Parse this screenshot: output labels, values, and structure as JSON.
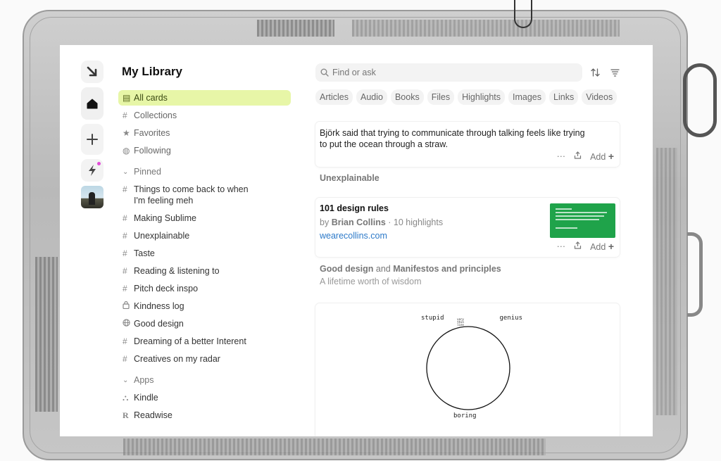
{
  "library": {
    "title": "My Library",
    "top_items": [
      {
        "label": "All cards",
        "icon": "cards-icon"
      },
      {
        "label": "Collections",
        "icon": "hash-icon"
      },
      {
        "label": "Favorites",
        "icon": "star-icon"
      },
      {
        "label": "Following",
        "icon": "following-icon"
      }
    ],
    "pinned_label": "Pinned",
    "pinned": [
      {
        "label": "Things to come back to when I'm feeling meh",
        "icon": "#"
      },
      {
        "label": "Making Sublime",
        "icon": "#"
      },
      {
        "label": "Unexplainable",
        "icon": "#"
      },
      {
        "label": "Taste",
        "icon": "#"
      },
      {
        "label": "Reading & listening to",
        "icon": "#"
      },
      {
        "label": "Pitch deck inspo",
        "icon": "#"
      },
      {
        "label": "Kindness log",
        "icon": "🔒"
      },
      {
        "label": "Good design",
        "icon": "🌐"
      },
      {
        "label": "Dreaming of a better Interent",
        "icon": "#"
      },
      {
        "label": "Creatives on my radar",
        "icon": "#"
      }
    ],
    "apps_label": "Apps",
    "apps": [
      {
        "label": "Kindle",
        "icon": "kindle-icon"
      },
      {
        "label": "Readwise",
        "icon": "R"
      }
    ]
  },
  "search": {
    "placeholder": "Find or ask"
  },
  "tabs": [
    "Articles",
    "Audio",
    "Books",
    "Files",
    "Highlights",
    "Images",
    "Links",
    "Videos"
  ],
  "cards": {
    "quote": {
      "text": "Björk said that trying to communicate through talking feels like trying to put the ocean through a straw.",
      "tag": "Unexplainable"
    },
    "book": {
      "title": "101 design rules",
      "by": "by",
      "author": "Brian Collins",
      "highlights": "· 10 highlights",
      "link": "wearecollins.com",
      "collection_a": "Good design",
      "and": "and",
      "collection_b": "Manifestos and principles",
      "description": "A lifetime worth of wisdom"
    },
    "diagram": {
      "top_left": "stupid",
      "top_right": "genius",
      "bottom": "boring",
      "tiny": "very thin line"
    },
    "actions": {
      "more": "···",
      "add": "Add"
    }
  },
  "colors": {
    "accent_bg": "#e7f6a7",
    "link": "#2d7ac9",
    "thumb": "#1fa34a",
    "badge": "#e24bd8"
  }
}
